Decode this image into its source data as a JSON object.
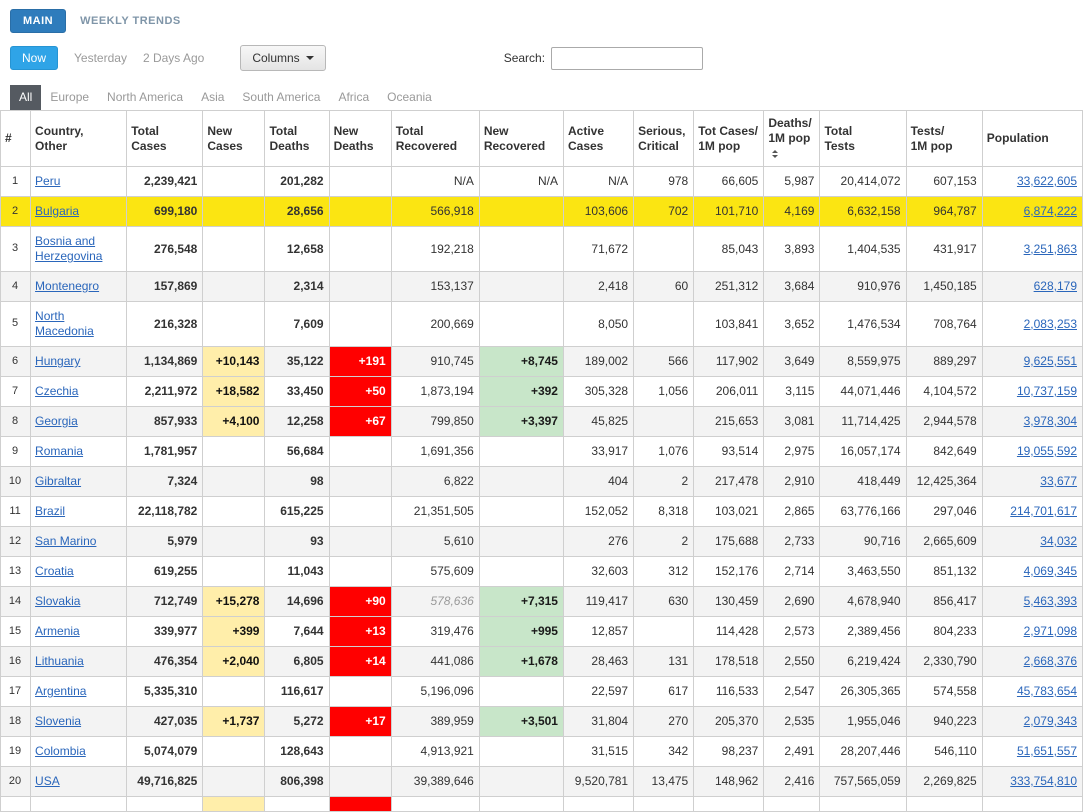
{
  "top_tabs": {
    "main": "MAIN",
    "weekly_trends": "WEEKLY TRENDS"
  },
  "toolbar": {
    "now": "Now",
    "yesterday": "Yesterday",
    "two_days_ago": "2 Days Ago",
    "columns_button": "Columns",
    "search_label": "Search:",
    "search_value": ""
  },
  "region_tabs": [
    {
      "key": "all",
      "label": "All",
      "active": true
    },
    {
      "key": "europe",
      "label": "Europe",
      "active": false
    },
    {
      "key": "north-america",
      "label": "North America",
      "active": false
    },
    {
      "key": "asia",
      "label": "Asia",
      "active": false
    },
    {
      "key": "south-america",
      "label": "South America",
      "active": false
    },
    {
      "key": "africa",
      "label": "Africa",
      "active": false
    },
    {
      "key": "oceania",
      "label": "Oceania",
      "active": false
    }
  ],
  "colors": {
    "highlight_row": "#fbe512",
    "new_cases_bg": "#ffeeaa",
    "new_deaths_bg": "#ff0000",
    "new_recovered_bg": "#c8e6c9",
    "accent_blue": "#2fa4e7",
    "link_blue": "#2a66bb"
  },
  "table": {
    "columns": [
      {
        "key": "num",
        "label": "#"
      },
      {
        "key": "country",
        "label": "Country,\nOther"
      },
      {
        "key": "total-cases",
        "label": "Total\nCases"
      },
      {
        "key": "new-cases",
        "label": "New\nCases"
      },
      {
        "key": "total-deaths",
        "label": "Total\nDeaths"
      },
      {
        "key": "new-deaths",
        "label": "New\nDeaths"
      },
      {
        "key": "total-recovered",
        "label": "Total\nRecovered"
      },
      {
        "key": "new-recovered",
        "label": "New\nRecovered"
      },
      {
        "key": "active-cases",
        "label": "Active\nCases"
      },
      {
        "key": "serious-critical",
        "label": "Serious,\nCritical"
      },
      {
        "key": "cases-per-1m",
        "label": "Tot Cases/\n1M pop"
      },
      {
        "key": "deaths-per-1m",
        "label": "Deaths/\n1M pop",
        "sorted": true
      },
      {
        "key": "total-tests",
        "label": "Total\nTests"
      },
      {
        "key": "tests-per-1m",
        "label": "Tests/\n1M pop"
      },
      {
        "key": "population",
        "label": "Population"
      }
    ],
    "rows": [
      {
        "num": "1",
        "country": "Peru",
        "total_cases": "2,239,421",
        "new_cases": "",
        "total_deaths": "201,282",
        "new_deaths": "",
        "total_recovered": "N/A",
        "new_recovered": "N/A",
        "active_cases": "N/A",
        "serious_critical": "978",
        "cases_per_1m": "66,605",
        "deaths_per_1m": "5,987",
        "total_tests": "20,414,072",
        "tests_per_1m": "607,153",
        "population": "33,622,605"
      },
      {
        "num": "2",
        "country": "Bulgaria",
        "total_cases": "699,180",
        "new_cases": "",
        "total_deaths": "28,656",
        "new_deaths": "",
        "total_recovered": "566,918",
        "new_recovered": "",
        "active_cases": "103,606",
        "serious_critical": "702",
        "cases_per_1m": "101,710",
        "deaths_per_1m": "4,169",
        "total_tests": "6,632,158",
        "tests_per_1m": "964,787",
        "population": "6,874,222",
        "highlight": true
      },
      {
        "num": "3",
        "country": "Bosnia and Herzegovina",
        "total_cases": "276,548",
        "new_cases": "",
        "total_deaths": "12,658",
        "new_deaths": "",
        "total_recovered": "192,218",
        "new_recovered": "",
        "active_cases": "71,672",
        "serious_critical": "",
        "cases_per_1m": "85,043",
        "deaths_per_1m": "3,893",
        "total_tests": "1,404,535",
        "tests_per_1m": "431,917",
        "population": "3,251,863"
      },
      {
        "num": "4",
        "country": "Montenegro",
        "total_cases": "157,869",
        "new_cases": "",
        "total_deaths": "2,314",
        "new_deaths": "",
        "total_recovered": "153,137",
        "new_recovered": "",
        "active_cases": "2,418",
        "serious_critical": "60",
        "cases_per_1m": "251,312",
        "deaths_per_1m": "3,684",
        "total_tests": "910,976",
        "tests_per_1m": "1,450,185",
        "population": "628,179"
      },
      {
        "num": "5",
        "country": "North Macedonia",
        "total_cases": "216,328",
        "new_cases": "",
        "total_deaths": "7,609",
        "new_deaths": "",
        "total_recovered": "200,669",
        "new_recovered": "",
        "active_cases": "8,050",
        "serious_critical": "",
        "cases_per_1m": "103,841",
        "deaths_per_1m": "3,652",
        "total_tests": "1,476,534",
        "tests_per_1m": "708,764",
        "population": "2,083,253"
      },
      {
        "num": "6",
        "country": "Hungary",
        "total_cases": "1,134,869",
        "new_cases": "+10,143",
        "total_deaths": "35,122",
        "new_deaths": "+191",
        "total_recovered": "910,745",
        "new_recovered": "+8,745",
        "active_cases": "189,002",
        "serious_critical": "566",
        "cases_per_1m": "117,902",
        "deaths_per_1m": "3,649",
        "total_tests": "8,559,975",
        "tests_per_1m": "889,297",
        "population": "9,625,551"
      },
      {
        "num": "7",
        "country": "Czechia",
        "total_cases": "2,211,972",
        "new_cases": "+18,582",
        "total_deaths": "33,450",
        "new_deaths": "+50",
        "total_recovered": "1,873,194",
        "new_recovered": "+392",
        "active_cases": "305,328",
        "serious_critical": "1,056",
        "cases_per_1m": "206,011",
        "deaths_per_1m": "3,115",
        "total_tests": "44,071,446",
        "tests_per_1m": "4,104,572",
        "population": "10,737,159"
      },
      {
        "num": "8",
        "country": "Georgia",
        "total_cases": "857,933",
        "new_cases": "+4,100",
        "total_deaths": "12,258",
        "new_deaths": "+67",
        "total_recovered": "799,850",
        "new_recovered": "+3,397",
        "active_cases": "45,825",
        "serious_critical": "",
        "cases_per_1m": "215,653",
        "deaths_per_1m": "3,081",
        "total_tests": "11,714,425",
        "tests_per_1m": "2,944,578",
        "population": "3,978,304"
      },
      {
        "num": "9",
        "country": "Romania",
        "total_cases": "1,781,957",
        "new_cases": "",
        "total_deaths": "56,684",
        "new_deaths": "",
        "total_recovered": "1,691,356",
        "new_recovered": "",
        "active_cases": "33,917",
        "serious_critical": "1,076",
        "cases_per_1m": "93,514",
        "deaths_per_1m": "2,975",
        "total_tests": "16,057,174",
        "tests_per_1m": "842,649",
        "population": "19,055,592"
      },
      {
        "num": "10",
        "country": "Gibraltar",
        "total_cases": "7,324",
        "new_cases": "",
        "total_deaths": "98",
        "new_deaths": "",
        "total_recovered": "6,822",
        "new_recovered": "",
        "active_cases": "404",
        "serious_critical": "2",
        "cases_per_1m": "217,478",
        "deaths_per_1m": "2,910",
        "total_tests": "418,449",
        "tests_per_1m": "12,425,364",
        "population": "33,677"
      },
      {
        "num": "11",
        "country": "Brazil",
        "total_cases": "22,118,782",
        "new_cases": "",
        "total_deaths": "615,225",
        "new_deaths": "",
        "total_recovered": "21,351,505",
        "new_recovered": "",
        "active_cases": "152,052",
        "serious_critical": "8,318",
        "cases_per_1m": "103,021",
        "deaths_per_1m": "2,865",
        "total_tests": "63,776,166",
        "tests_per_1m": "297,046",
        "population": "214,701,617"
      },
      {
        "num": "12",
        "country": "San Marino",
        "total_cases": "5,979",
        "new_cases": "",
        "total_deaths": "93",
        "new_deaths": "",
        "total_recovered": "5,610",
        "new_recovered": "",
        "active_cases": "276",
        "serious_critical": "2",
        "cases_per_1m": "175,688",
        "deaths_per_1m": "2,733",
        "total_tests": "90,716",
        "tests_per_1m": "2,665,609",
        "population": "34,032"
      },
      {
        "num": "13",
        "country": "Croatia",
        "total_cases": "619,255",
        "new_cases": "",
        "total_deaths": "11,043",
        "new_deaths": "",
        "total_recovered": "575,609",
        "new_recovered": "",
        "active_cases": "32,603",
        "serious_critical": "312",
        "cases_per_1m": "152,176",
        "deaths_per_1m": "2,714",
        "total_tests": "3,463,550",
        "tests_per_1m": "851,132",
        "population": "4,069,345"
      },
      {
        "num": "14",
        "country": "Slovakia",
        "total_cases": "712,749",
        "new_cases": "+15,278",
        "total_deaths": "14,696",
        "new_deaths": "+90",
        "total_recovered": "578,636",
        "recovered_est": true,
        "new_recovered": "+7,315",
        "active_cases": "119,417",
        "serious_critical": "630",
        "cases_per_1m": "130,459",
        "deaths_per_1m": "2,690",
        "total_tests": "4,678,940",
        "tests_per_1m": "856,417",
        "population": "5,463,393"
      },
      {
        "num": "15",
        "country": "Armenia",
        "total_cases": "339,977",
        "new_cases": "+399",
        "total_deaths": "7,644",
        "new_deaths": "+13",
        "total_recovered": "319,476",
        "new_recovered": "+995",
        "active_cases": "12,857",
        "serious_critical": "",
        "cases_per_1m": "114,428",
        "deaths_per_1m": "2,573",
        "total_tests": "2,389,456",
        "tests_per_1m": "804,233",
        "population": "2,971,098"
      },
      {
        "num": "16",
        "country": "Lithuania",
        "total_cases": "476,354",
        "new_cases": "+2,040",
        "total_deaths": "6,805",
        "new_deaths": "+14",
        "total_recovered": "441,086",
        "new_recovered": "+1,678",
        "active_cases": "28,463",
        "serious_critical": "131",
        "cases_per_1m": "178,518",
        "deaths_per_1m": "2,550",
        "total_tests": "6,219,424",
        "tests_per_1m": "2,330,790",
        "population": "2,668,376"
      },
      {
        "num": "17",
        "country": "Argentina",
        "total_cases": "5,335,310",
        "new_cases": "",
        "total_deaths": "116,617",
        "new_deaths": "",
        "total_recovered": "5,196,096",
        "new_recovered": "",
        "active_cases": "22,597",
        "serious_critical": "617",
        "cases_per_1m": "116,533",
        "deaths_per_1m": "2,547",
        "total_tests": "26,305,365",
        "tests_per_1m": "574,558",
        "population": "45,783,654"
      },
      {
        "num": "18",
        "country": "Slovenia",
        "total_cases": "427,035",
        "new_cases": "+1,737",
        "total_deaths": "5,272",
        "new_deaths": "+17",
        "total_recovered": "389,959",
        "new_recovered": "+3,501",
        "active_cases": "31,804",
        "serious_critical": "270",
        "cases_per_1m": "205,370",
        "deaths_per_1m": "2,535",
        "total_tests": "1,955,046",
        "tests_per_1m": "940,223",
        "population": "2,079,343"
      },
      {
        "num": "19",
        "country": "Colombia",
        "total_cases": "5,074,079",
        "new_cases": "",
        "total_deaths": "128,643",
        "new_deaths": "",
        "total_recovered": "4,913,921",
        "new_recovered": "",
        "active_cases": "31,515",
        "serious_critical": "342",
        "cases_per_1m": "98,237",
        "deaths_per_1m": "2,491",
        "total_tests": "28,207,446",
        "tests_per_1m": "546,110",
        "population": "51,651,557"
      },
      {
        "num": "20",
        "country": "USA",
        "total_cases": "49,716,825",
        "new_cases": "",
        "total_deaths": "806,398",
        "new_deaths": "",
        "total_recovered": "39,389,646",
        "new_recovered": "",
        "active_cases": "9,520,781",
        "serious_critical": "13,475",
        "cases_per_1m": "148,962",
        "deaths_per_1m": "2,416",
        "total_tests": "757,565,059",
        "tests_per_1m": "2,269,825",
        "population": "333,754,810"
      },
      {
        "num": "",
        "country": "",
        "total_cases": "",
        "new_cases": "",
        "total_deaths": "",
        "new_deaths": "",
        "total_recovered": "",
        "new_recovered": "",
        "active_cases": "",
        "serious_critical": "",
        "cases_per_1m": "",
        "deaths_per_1m": "",
        "total_tests": "",
        "tests_per_1m": "",
        "population": "",
        "partial": true
      }
    ]
  }
}
